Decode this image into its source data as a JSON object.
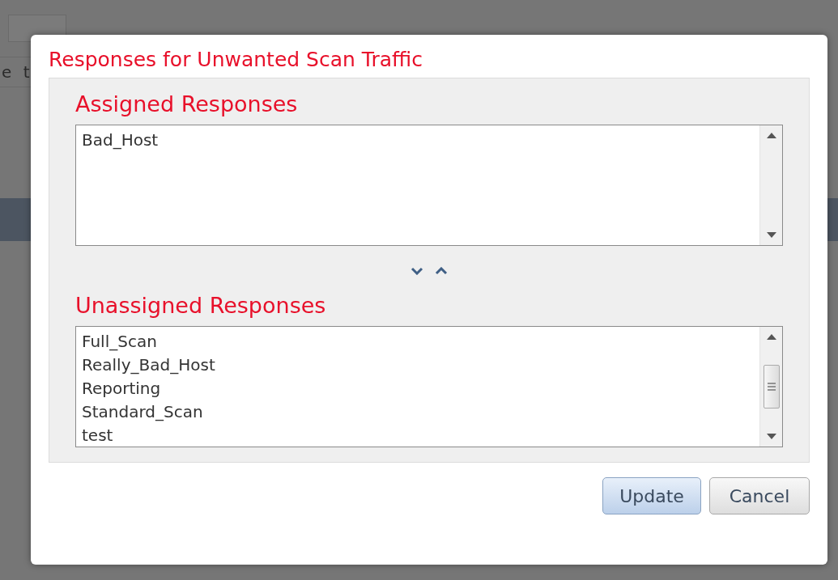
{
  "background": {
    "fragment": "e t"
  },
  "dialog": {
    "title": "Responses for Unwanted Scan Traffic",
    "assigned": {
      "heading": "Assigned Responses",
      "items": [
        "Bad_Host"
      ]
    },
    "unassigned": {
      "heading": "Unassigned Responses",
      "items": [
        "Full_Scan",
        "Really_Bad_Host",
        "Reporting",
        "Standard_Scan",
        "test"
      ]
    },
    "buttons": [
      {
        "label": "Update",
        "kind": "primary"
      },
      {
        "label": "Cancel",
        "kind": "secondary"
      }
    ]
  }
}
